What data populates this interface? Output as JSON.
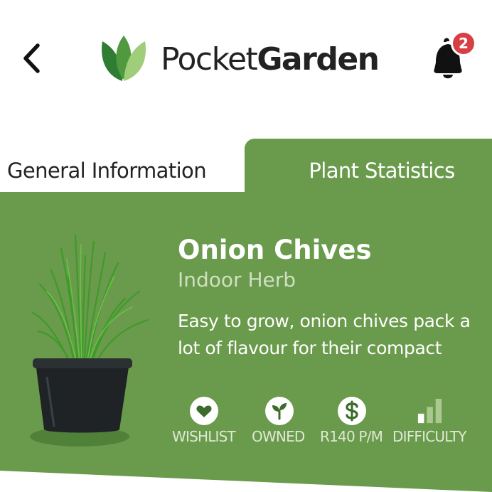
{
  "header": {
    "back_icon": "chevron-left-icon",
    "brand_light": "Pocket",
    "brand_bold": "Garden",
    "logo_icon": "leaf-logo-icon",
    "notification_icon": "bell-icon",
    "notification_count": "2",
    "badge_color": "#d64045"
  },
  "tabs": {
    "general": "General Information",
    "statistics": "Plant Statistics",
    "active": "Plant Statistics"
  },
  "plant": {
    "name": "Onion Chives",
    "category": "Indoor Herb",
    "description": "Easy to grow,  onion chives pack a lot of flavour for their compact",
    "image": "potted-chives-image"
  },
  "stats": {
    "wishlist": {
      "label": "WISHLIST",
      "icon": "heart-icon"
    },
    "owned": {
      "label": "OWNED",
      "icon": "sprout-icon"
    },
    "price": {
      "label": "R140 P/M",
      "icon": "dollar-icon"
    },
    "difficulty": {
      "label": "DIFFICULTY",
      "icon": "difficulty-bars-icon",
      "level": 1,
      "max": 3
    }
  },
  "colors": {
    "panel_green": "#6a9a4b",
    "text_dark": "#222222",
    "subtitle": "#cfe0c2"
  }
}
